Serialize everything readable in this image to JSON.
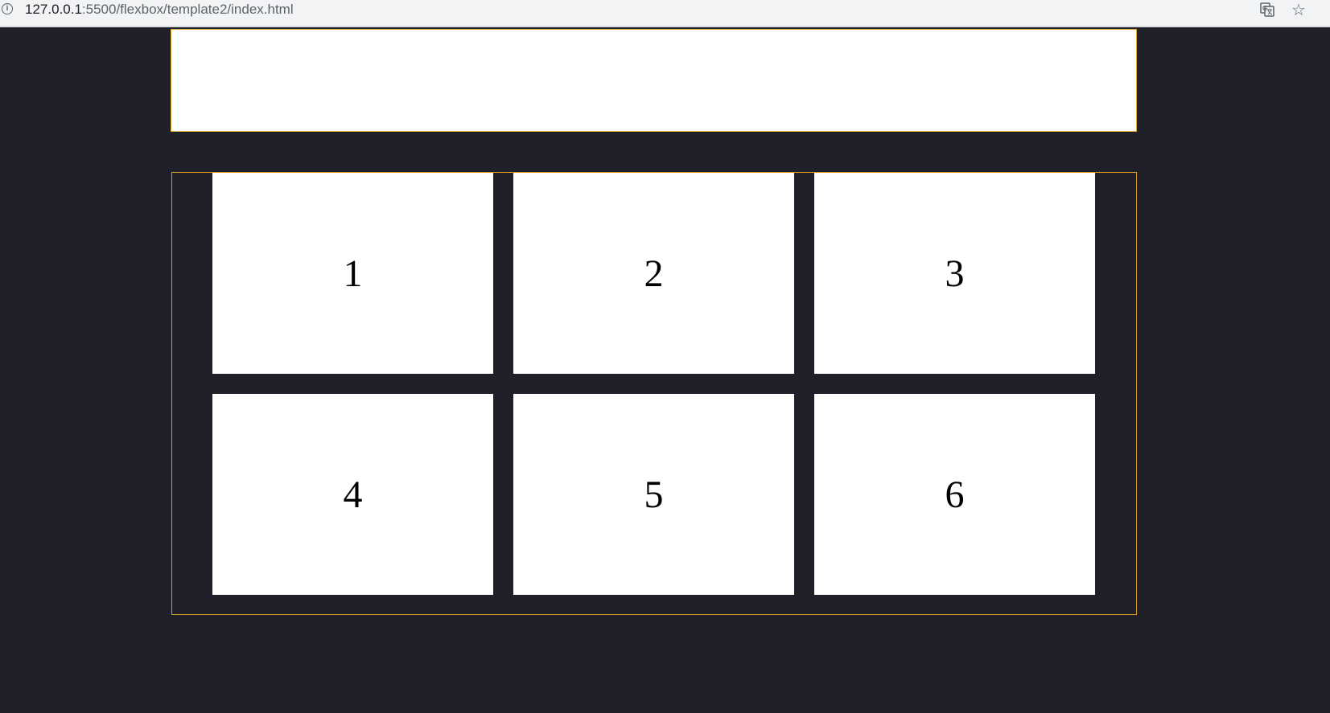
{
  "browser": {
    "url_host": "127.0.0.1",
    "url_path": ":5500/flexbox/template2/index.html",
    "icons": [
      "info-icon",
      "translate-icon",
      "star-icon"
    ]
  },
  "page": {
    "grid": {
      "items": [
        "1",
        "2",
        "3",
        "4",
        "5",
        "6"
      ]
    }
  },
  "colors": {
    "background": "#20202b",
    "border_accent": "#e6a82a",
    "box": "#ffffff"
  }
}
